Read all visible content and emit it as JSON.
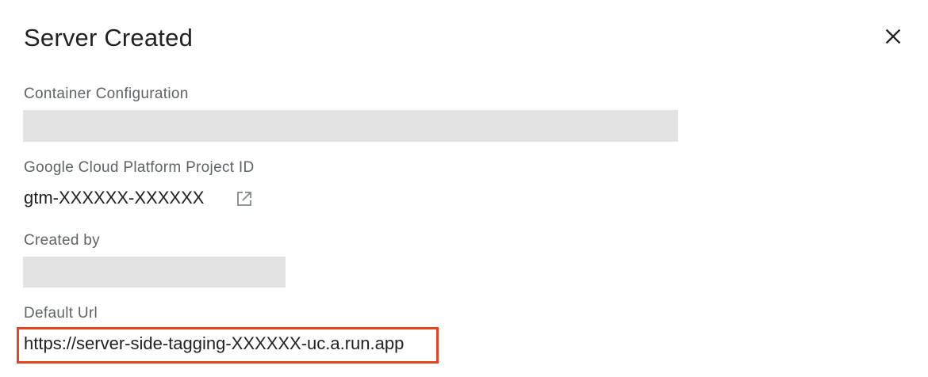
{
  "dialog": {
    "title": "Server Created",
    "close_icon": "close-icon"
  },
  "fields": {
    "container_configuration": {
      "label": "Container Configuration"
    },
    "project_id": {
      "label": "Google Cloud Platform Project ID",
      "value": "gtm-XXXXXX-XXXXXX",
      "link_icon": "open-in-new-icon"
    },
    "created_by": {
      "label": "Created by"
    },
    "default_url": {
      "label": "Default Url",
      "value": "https://server-side-tagging-XXXXXX-uc.a.run.app"
    }
  },
  "colors": {
    "highlight_border": "#e8431f",
    "redaction": "#e3e3e3",
    "label_text": "#5f6368",
    "body_text": "#202124"
  }
}
